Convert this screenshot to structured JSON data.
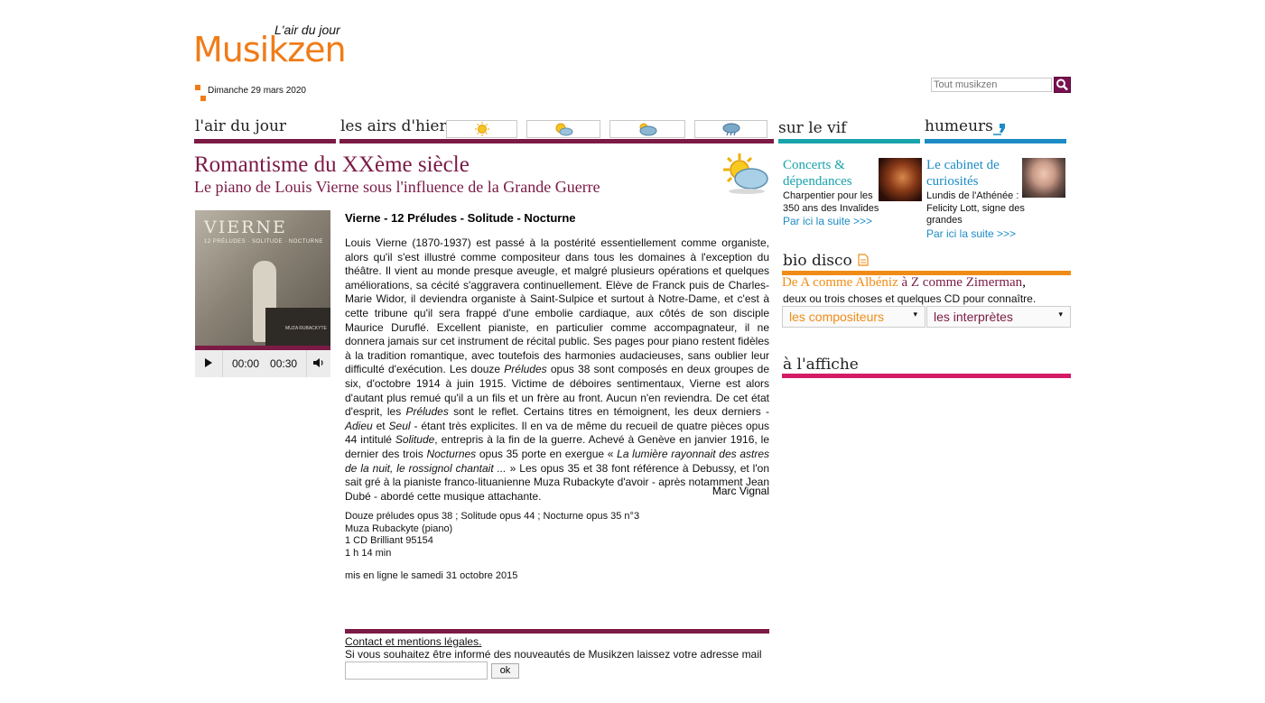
{
  "header": {
    "tagline": "L'air du jour",
    "logo": "Musikzen",
    "date": "Dimanche 29 mars 2020",
    "search_placeholder": "Tout musikzen"
  },
  "nav": {
    "air_du_jour": "l'air du jour",
    "airs_d_hier": "les airs d'hier",
    "sur_le_vif": "sur le vif",
    "humeurs": "humeurs",
    "weather_buttons": [
      "sun-icon",
      "sun-cloud-icon",
      "cloud-sun-icon",
      "cloud-rain-icon"
    ],
    "colors": {
      "plum": "#7b1a44",
      "teal": "#19a3ad",
      "blue": "#1c8bc5",
      "orange": "#f08c16",
      "pink": "#d41b64"
    }
  },
  "article": {
    "title": "Romantisme du XXème siècle",
    "subtitle": "Le piano de Louis Vierne sous l'influence de la Grande Guerre",
    "heading": "Vierne - 12 Préludes - Solitude - Nocturne",
    "cover": {
      "title": "VIERNE",
      "subtitle": "12 PRÉLUDES · SOLITUDE · NOCTURNE",
      "artist": "MUZA RUBACKYTE"
    },
    "player": {
      "current_time": "00:00",
      "duration": "00:30"
    },
    "body": [
      "Louis Vierne (1870-1937) est passé à la postérité essentiellement comme organiste, alors qu'il s'est illustré comme compositeur dans tous les domaines à l'exception du théâtre. Il vient au monde presque aveugle, et malgré plusieurs opérations et quelques améliorations, sa cécité s'aggravera continuellement. Elève de Franck puis de Charles-Marie Widor, il deviendra organiste à Saint-Sulpice et surtout à Notre-Dame, et c'est à cette tribune qu'il sera frappé d'une embolie cardiaque, aux côtés de son disciple Maurice Duruflé. Excellent pianiste, en particulier comme accompagnateur, il ne donnera jamais sur cet instrument de récital public. Ses pages pour piano restent fidèles à la tradition romantique, avec toutefois des harmonies audacieuses, sans oublier leur difficulté d'exécution. Les douze ",
      "Préludes",
      " opus 38 sont composés en deux groupes de six, d'octobre 1914 à juin 1915. Victime de déboires sentimentaux, Vierne est alors d'autant plus remué qu'il a un fils et un frère au front. Aucun n'en reviendra. De cet état d'esprit, les ",
      "Préludes",
      " sont le reflet. Certains titres en témoignent, les deux derniers - ",
      "Adieu",
      " et ",
      "Seul",
      " - étant très explicites. Il en va de même du recueil de quatre pièces opus 44 intitulé ",
      "Solitude",
      ", entrepris à la fin de la guerre. Achevé à Genève en janvier 1916, le dernier des trois ",
      "Nocturnes",
      " opus 35 porte en exergue « ",
      "La lumière rayonnait des astres de la nuit, le rossignol chantait ...",
      " » Les opus 35 et 38 font référence à Debussy, et l'on sait gré à la pianiste franco-lituanienne Muza Rubackyte d'avoir - après notamment Jean Dubé - abordé cette musique attachante."
    ],
    "author": "Marc Vignal",
    "disc_lines": [
      "Douze préludes opus 38 ; Solitude opus 44 ; Nocturne opus 35 n°3",
      "Muza Rubackyte (piano)",
      "1 CD Brilliant 95154",
      "1 h 14 min"
    ],
    "published": "mis en ligne le samedi 31 octobre 2015"
  },
  "footer": {
    "contact": "Contact et mentions légales.",
    "newsletter": "Si vous souhaitez être informé des nouveautés de Musikzen laissez votre adresse mail",
    "ok": "ok"
  },
  "sidebar": {
    "concerts": {
      "title": "Concerts & dépendances",
      "text": "Charpentier pour les 350 ans des Invalides",
      "link": "Par ici la suite >>>"
    },
    "cabinet": {
      "title": "Le cabinet de curiosités",
      "text": "Lundis de l'Athénée : Felicity Lott, signe des grandes",
      "link": "Par ici la suite >>>"
    },
    "bio_disco": {
      "label": "bio disco",
      "line_part1": "De A comme Albéniz",
      "line_part2": " à Z comme Zimerman",
      "line_part3": ",",
      "line2": "deux ou trois choses et quelques CD pour connaître.",
      "select_composers": "les compositeurs",
      "select_performers": "les interprètes"
    },
    "affiche": "à l'affiche"
  }
}
